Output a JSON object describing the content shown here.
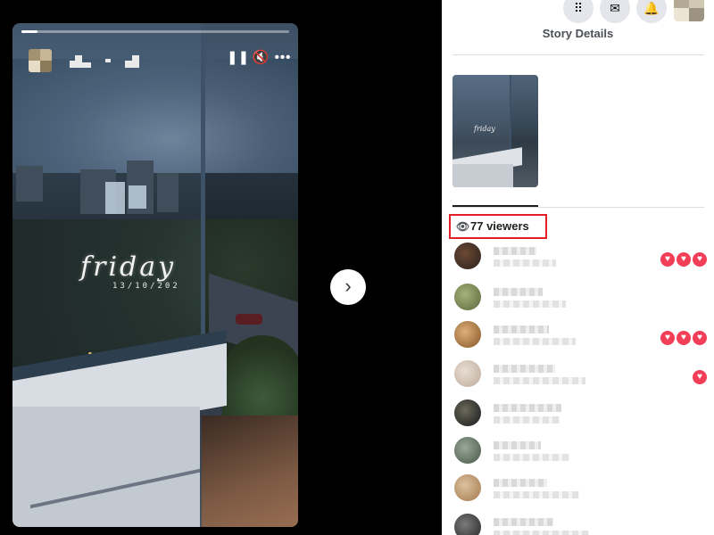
{
  "story": {
    "progress_fraction": 0.06,
    "overlay_text": "friday",
    "overlay_date": "13/10/202",
    "controls": {
      "pause_icon": "pause-icon",
      "mute_icon": "mute-icon",
      "more_icon": "more-icon"
    },
    "pause_glyph": "❚❚",
    "mute_glyph": "🔇",
    "more_glyph": "•••"
  },
  "navigation": {
    "next_glyph": "›"
  },
  "panel": {
    "title": "Story Details",
    "top_icons": [
      "apps-grid-icon",
      "messenger-icon",
      "bell-icon"
    ],
    "grid_glyph": "⠿",
    "messenger_glyph": "✉",
    "bell_glyph": "🔔",
    "viewers_label": "77 viewers",
    "eye_glyph": "👁",
    "accent_color": "#e41e26",
    "reaction_color": "#f33e58",
    "viewers": [
      {
        "reactions": 3
      },
      {
        "reactions": 0
      },
      {
        "reactions": 3
      },
      {
        "reactions": 1
      },
      {
        "reactions": 0
      },
      {
        "reactions": 0
      },
      {
        "reactions": 0
      },
      {
        "reactions": 0
      }
    ]
  }
}
